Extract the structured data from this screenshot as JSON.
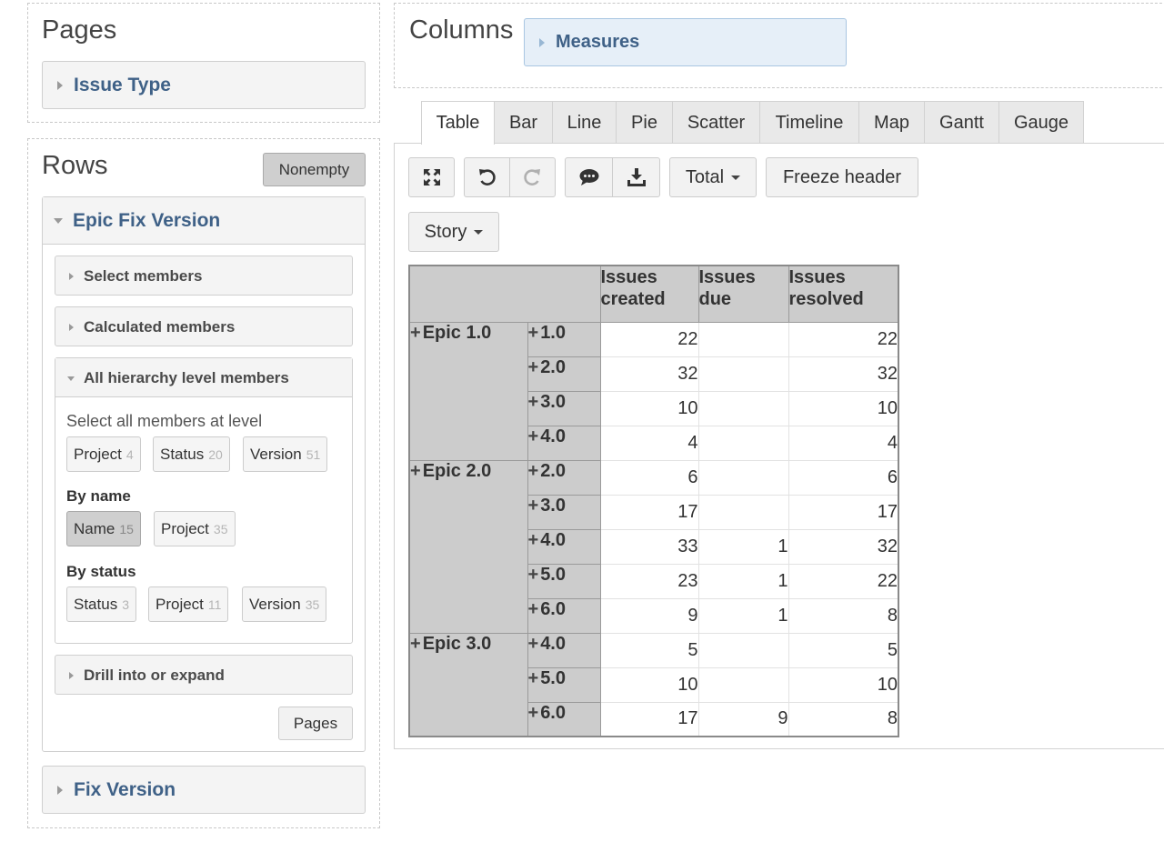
{
  "pages": {
    "title": "Pages",
    "dimension": "Issue Type"
  },
  "columns": {
    "title": "Columns",
    "dimension": "Measures"
  },
  "rows": {
    "title": "Rows",
    "nonempty_label": "Nonempty",
    "dimension": "Epic Fix Version",
    "select_members": "Select members",
    "calculated_members": "Calculated members",
    "all_hierarchy": "All hierarchy level members",
    "select_all_label": "Select all members at level",
    "level_chips": [
      {
        "label": "Project",
        "count": "4"
      },
      {
        "label": "Status",
        "count": "20"
      },
      {
        "label": "Version",
        "count": "51"
      }
    ],
    "by_name_label": "By name",
    "by_name_chips": [
      {
        "label": "Name",
        "count": "15"
      },
      {
        "label": "Project",
        "count": "35"
      }
    ],
    "by_status_label": "By status",
    "by_status_chips": [
      {
        "label": "Status",
        "count": "3"
      },
      {
        "label": "Project",
        "count": "11"
      },
      {
        "label": "Version",
        "count": "35"
      }
    ],
    "drill_label": "Drill into or expand",
    "pages_button": "Pages",
    "second_dimension": "Fix Version"
  },
  "tabs": [
    "Table",
    "Bar",
    "Line",
    "Pie",
    "Scatter",
    "Timeline",
    "Map",
    "Gantt",
    "Gauge"
  ],
  "active_tab": "Table",
  "toolbar": {
    "total_label": "Total",
    "freeze_label": "Freeze header",
    "story_label": "Story"
  },
  "table": {
    "headers": [
      "Issues created",
      "Issues due",
      "Issues resolved"
    ],
    "epics": [
      {
        "name": "Epic 1.0",
        "rows": [
          {
            "version": "1.0",
            "created": "22",
            "due": "",
            "resolved": "22"
          },
          {
            "version": "2.0",
            "created": "32",
            "due": "",
            "resolved": "32"
          },
          {
            "version": "3.0",
            "created": "10",
            "due": "",
            "resolved": "10"
          },
          {
            "version": "4.0",
            "created": "4",
            "due": "",
            "resolved": "4"
          }
        ]
      },
      {
        "name": "Epic 2.0",
        "rows": [
          {
            "version": "2.0",
            "created": "6",
            "due": "",
            "resolved": "6"
          },
          {
            "version": "3.0",
            "created": "17",
            "due": "",
            "resolved": "17"
          },
          {
            "version": "4.0",
            "created": "33",
            "due": "1",
            "resolved": "32"
          },
          {
            "version": "5.0",
            "created": "23",
            "due": "1",
            "resolved": "22"
          },
          {
            "version": "6.0",
            "created": "9",
            "due": "1",
            "resolved": "8"
          }
        ]
      },
      {
        "name": "Epic 3.0",
        "rows": [
          {
            "version": "4.0",
            "created": "5",
            "due": "",
            "resolved": "5"
          },
          {
            "version": "5.0",
            "created": "10",
            "due": "",
            "resolved": "10"
          },
          {
            "version": "6.0",
            "created": "17",
            "due": "9",
            "resolved": "8"
          }
        ]
      }
    ]
  }
}
